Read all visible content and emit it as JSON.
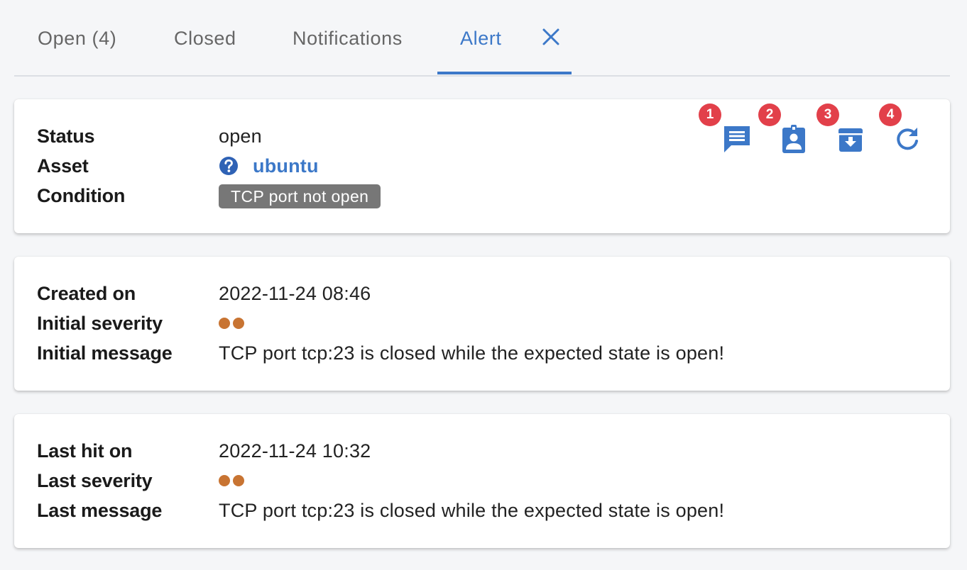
{
  "tabs": [
    {
      "label": "Open (4)"
    },
    {
      "label": "Closed"
    },
    {
      "label": "Notifications"
    },
    {
      "label": "Alert",
      "active": true
    }
  ],
  "colors": {
    "accent": "#3c78c8",
    "badge": "#e2404a",
    "severity": "#c87432",
    "chip_bg": "#777777"
  },
  "alert": {
    "status_label": "Status",
    "status_value": "open",
    "asset_label": "Asset",
    "asset_value": "ubuntu",
    "condition_label": "Condition",
    "condition_value": "TCP port not open"
  },
  "actions": [
    {
      "icon": "comment-icon",
      "badge": "1"
    },
    {
      "icon": "assign-user-icon",
      "badge": "2"
    },
    {
      "icon": "archive-icon",
      "badge": "3"
    },
    {
      "icon": "refresh-icon",
      "badge": "4"
    }
  ],
  "initial": {
    "created_label": "Created on",
    "created_value": "2022-11-24 08:46",
    "severity_label": "Initial severity",
    "severity_level": 2,
    "message_label": "Initial message",
    "message_value": "TCP port tcp:23 is closed while the expected state is open!"
  },
  "last": {
    "hit_label": "Last hit on",
    "hit_value": "2022-11-24 10:32",
    "severity_label": "Last severity",
    "severity_level": 2,
    "message_label": "Last message",
    "message_value": "TCP port tcp:23 is closed while the expected state is open!"
  }
}
